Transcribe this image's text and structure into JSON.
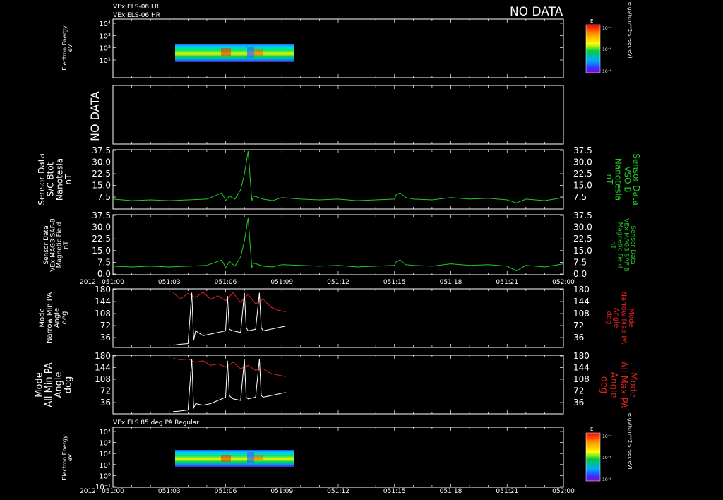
{
  "header": {
    "line1": "VEx ELS-06 LR",
    "line2": "VEx ELS-06 HR",
    "no_data": "NO DATA"
  },
  "colors": {
    "background": "#000000",
    "frame": "#ffffff",
    "green": "#22cc22",
    "red": "#dd2222",
    "white": "#ffffff"
  },
  "x_axis": {
    "year_label": "2012",
    "ticks": [
      "051:00",
      "051:03",
      "051:06",
      "051:09",
      "051:12",
      "051:15",
      "051:18",
      "051:21",
      "052:00"
    ]
  },
  "panels": {
    "spec_top": {
      "ylabel": [
        "Electron Energy",
        "eV"
      ],
      "yticks": [
        "10⁴",
        "10³",
        "10²",
        "10¹"
      ],
      "colorbar": {
        "title": "El",
        "ticks": [
          "10⁻⁴",
          "10⁻⁶",
          "10⁻⁸"
        ]
      },
      "unit": "ergs/(cm**2-sr-sec-eV)"
    },
    "nodata": {
      "label": "NO DATA"
    },
    "btot": {
      "ylabel": [
        "Sensor Data",
        "S/C Btot",
        "Nanotesla",
        "nT"
      ],
      "rlabel": [
        "Sensor Data",
        "VSO B",
        "Nanotesla",
        "nT"
      ],
      "yticks": [
        "37.5",
        "30.0",
        "22.5",
        "15.0",
        "7.5"
      ]
    },
    "mag": {
      "ylabel": [
        "Sensor Data",
        "VEx MAG3 SAF-B",
        "Magnetic Field",
        "nT"
      ],
      "rlabel": [
        "Sensor Data",
        "VEx MAG3 SAF-B",
        "Magnetic Field",
        "nT"
      ],
      "yticks": [
        "37.5",
        "30.0",
        "22.5",
        "15.0",
        "7.5",
        "0.0"
      ]
    },
    "pa_narrow": {
      "ylabel": [
        "Mode",
        "Narrow Min PA",
        "Angle",
        "deg"
      ],
      "rlabel": [
        "Mode",
        "Narrow Max PA",
        "Angle",
        "deg"
      ],
      "yticks": [
        "180",
        "144",
        "108",
        "72",
        "36"
      ]
    },
    "pa_all": {
      "ylabel": [
        "Mode",
        "All Min PA",
        "Angle",
        "deg"
      ],
      "rlabel": [
        "Mode",
        "All Max PA",
        "Angle",
        "deg"
      ],
      "yticks": [
        "180",
        "144",
        "108",
        "72",
        "36"
      ]
    },
    "spec_bottom": {
      "title": "VEx ELS 85 deg PA Regular",
      "ylabel": [
        "Electron Energy",
        "eV"
      ],
      "yticks": [
        "10⁴",
        "10³",
        "10²",
        "10¹",
        "10⁰",
        "10⁻¹"
      ],
      "colorbar": {
        "title": "El",
        "ticks": [
          "10⁻⁴",
          "10⁻⁶",
          "10⁻⁸"
        ]
      },
      "unit": "ergs/(cm**2-sr-sec-eV)"
    }
  },
  "chart_data": [
    {
      "type": "heatmap",
      "title": "VEx ELS-06 LR / VEx ELS-06 HR",
      "ylabel": "Electron Energy eV",
      "x_range": [
        "051:03",
        "051:09"
      ],
      "y_range_log10": [
        1,
        2.4
      ],
      "colorbar_range": [
        "10⁻⁸",
        "10⁻⁴"
      ],
      "colorbar_unit": "ergs/(cm**2-sr-sec-eV)"
    },
    {
      "type": "line",
      "title": "S/C Btot",
      "ylabel": "nT",
      "ylim": [
        0,
        37.5
      ],
      "x": [
        0,
        1,
        2,
        3,
        4,
        5,
        5.8,
        6.0,
        6.2,
        6.5,
        6.8,
        7.0,
        7.2,
        7.4,
        7.5,
        8,
        8.5,
        9,
        10,
        11,
        12,
        13,
        14,
        15,
        15.1,
        15.3,
        15.6,
        16,
        17,
        18,
        19,
        20,
        21,
        21.5,
        22,
        23,
        24
      ],
      "values": [
        6,
        5,
        5.5,
        5,
        5.5,
        6,
        10,
        5,
        8,
        6,
        12,
        22,
        37,
        5,
        8,
        6,
        5,
        7,
        6,
        5.5,
        6,
        5,
        5.5,
        6,
        9,
        10,
        7,
        6,
        5.5,
        7,
        6,
        6.5,
        5.5,
        3.5,
        6,
        5,
        7
      ]
    },
    {
      "type": "line",
      "title": "VEx MAG3 SAF-B",
      "ylabel": "nT",
      "ylim": [
        0,
        37.5
      ],
      "x": [
        0,
        1,
        2,
        3,
        4,
        5,
        5.8,
        6.0,
        6.2,
        6.5,
        6.8,
        7.0,
        7.2,
        7.4,
        7.5,
        8,
        8.5,
        9,
        10,
        11,
        12,
        13,
        14,
        15,
        15.1,
        15.3,
        15.6,
        16,
        17,
        18,
        19,
        20,
        21,
        21.5,
        22,
        23,
        24
      ],
      "values": [
        5,
        4.5,
        5,
        4.5,
        5,
        5.5,
        9,
        4,
        8,
        5,
        11,
        21,
        36,
        4,
        7,
        5,
        4.5,
        6,
        5.5,
        5,
        5.5,
        4.5,
        5,
        5.5,
        8,
        9,
        6,
        5.5,
        5,
        6.5,
        5.5,
        6,
        5,
        2,
        5.5,
        4.5,
        6.5
      ]
    },
    {
      "type": "line",
      "title": "Narrow Min/Max PA",
      "ylabel": "deg",
      "ylim": [
        0,
        180
      ],
      "series": [
        {
          "name": "Narrow Max PA",
          "color": "#dd2222",
          "x": [
            3.2,
            3.6,
            4.0,
            4.4,
            4.8,
            5.2,
            5.6,
            6.0,
            6.4,
            6.8,
            7.2,
            7.6,
            8.0,
            8.4,
            8.8,
            9.2
          ],
          "values": [
            170,
            150,
            168,
            155,
            172,
            150,
            160,
            145,
            170,
            140,
            165,
            135,
            150,
            125,
            115,
            110
          ]
        },
        {
          "name": "Narrow Min PA",
          "color": "#ffffff",
          "x": [
            3.2,
            3.6,
            4.0,
            4.2,
            4.3,
            4.4,
            4.8,
            5.2,
            5.6,
            6.0,
            6.1,
            6.2,
            6.4,
            6.8,
            7.0,
            7.1,
            7.2,
            7.6,
            7.8,
            7.9,
            8.0,
            8.4,
            8.8,
            9.2
          ],
          "values": [
            5,
            8,
            10,
            170,
            20,
            50,
            35,
            40,
            45,
            50,
            160,
            55,
            50,
            45,
            170,
            60,
            50,
            55,
            170,
            60,
            50,
            55,
            60,
            65
          ]
        }
      ]
    },
    {
      "type": "line",
      "title": "All Min/Max PA",
      "ylabel": "deg",
      "ylim": [
        0,
        180
      ],
      "series": [
        {
          "name": "All Max PA",
          "color": "#dd2222",
          "x": [
            3.2,
            3.6,
            4.0,
            4.4,
            4.8,
            5.2,
            5.6,
            6.0,
            6.4,
            6.8,
            7.2,
            7.6,
            8.0,
            8.4,
            8.8,
            9.2
          ],
          "values": [
            172,
            168,
            170,
            160,
            165,
            150,
            155,
            145,
            160,
            140,
            150,
            135,
            140,
            125,
            120,
            115
          ]
        },
        {
          "name": "All Min PA",
          "color": "#ffffff",
          "x": [
            3.2,
            3.6,
            4.0,
            4.2,
            4.3,
            4.4,
            4.8,
            5.2,
            5.6,
            6.0,
            6.1,
            6.2,
            6.4,
            6.8,
            7.0,
            7.1,
            7.2,
            7.6,
            7.8,
            7.9,
            8.0,
            8.4,
            8.8,
            9.2
          ],
          "values": [
            5,
            7,
            10,
            170,
            15,
            30,
            25,
            30,
            40,
            50,
            165,
            55,
            45,
            40,
            170,
            50,
            45,
            50,
            170,
            55,
            50,
            55,
            60,
            65
          ]
        }
      ]
    },
    {
      "type": "heatmap",
      "title": "VEx ELS 85 deg PA Regular",
      "ylabel": "Electron Energy eV",
      "x_range": [
        "051:03",
        "051:09"
      ],
      "y_range_log10": [
        1,
        2.4
      ],
      "colorbar_range": [
        "10⁻⁸",
        "10⁻⁴"
      ],
      "colorbar_unit": "ergs/(cm**2-sr-sec-eV)"
    }
  ]
}
